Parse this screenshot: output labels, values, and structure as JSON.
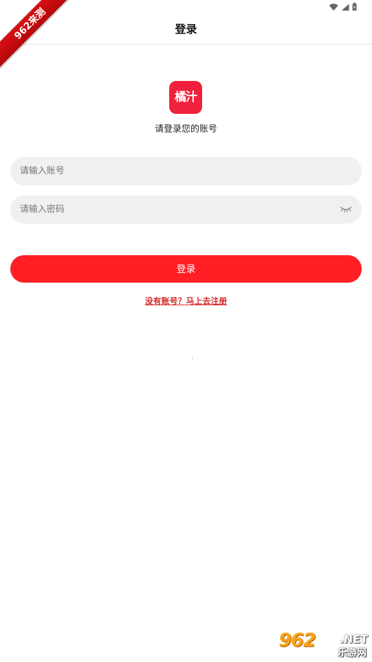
{
  "watermark_top": {
    "label": "962来测"
  },
  "header": {
    "title": "登录"
  },
  "logo": {
    "text": "橘汁"
  },
  "prompt": "请登录您的账号",
  "account_field": {
    "placeholder": "请输入账号",
    "value": ""
  },
  "password_field": {
    "placeholder": "请输入密码",
    "value": ""
  },
  "login_button": {
    "label": "登录"
  },
  "register_link": {
    "label": "没有账号？马上去注册"
  },
  "watermark_bottom": {
    "main": "962",
    "net": ".NET",
    "sub": "乐游网"
  },
  "colors": {
    "accent": "#ff1f25",
    "logo_bg": "#f0213c",
    "link": "#d42a2a",
    "input_bg": "#f0f0f0"
  },
  "icons": {
    "status": [
      "wifi-icon",
      "signal-icon",
      "battery-icon"
    ],
    "password_toggle": "eye-closed-icon"
  }
}
